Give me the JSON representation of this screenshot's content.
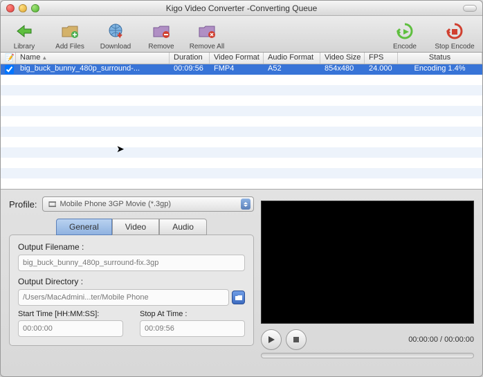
{
  "window": {
    "title": "Kigo Video Converter -Converting Queue"
  },
  "toolbar": {
    "library": "Library",
    "add_files": "Add Files",
    "download": "Download",
    "remove": "Remove",
    "remove_all": "Remove All",
    "encode": "Encode",
    "stop_encode": "Stop Encode"
  },
  "table": {
    "columns": {
      "name": "Name",
      "duration": "Duration",
      "video_format": "Video Format",
      "audio_format": "Audio Format",
      "video_size": "Video Size",
      "fps": "FPS",
      "status": "Status"
    },
    "rows": [
      {
        "checked": true,
        "name": "big_buck_bunny_480p_surround-...",
        "duration": "00:09:56",
        "video_format": "FMP4",
        "audio_format": "A52",
        "video_size": "854x480",
        "fps": "24.000",
        "status": "Encoding 1.4%"
      }
    ]
  },
  "profile": {
    "label": "Profile:",
    "selected": "Mobile Phone 3GP Movie (*.3gp)"
  },
  "tabs": {
    "general": "General",
    "video": "Video",
    "audio": "Audio"
  },
  "general": {
    "output_filename_label": "Output Filename :",
    "output_filename": "big_buck_bunny_480p_surround-fix.3gp",
    "output_directory_label": "Output Directory :",
    "output_directory": "/Users/MacAdmini...ter/Mobile Phone",
    "start_time_label": "Start Time [HH:MM:SS]:",
    "start_time": "00:00:00",
    "stop_time_label": "Stop At Time :",
    "stop_time": "00:09:56"
  },
  "player": {
    "time_display": "00:00:00 / 00:00:00"
  }
}
